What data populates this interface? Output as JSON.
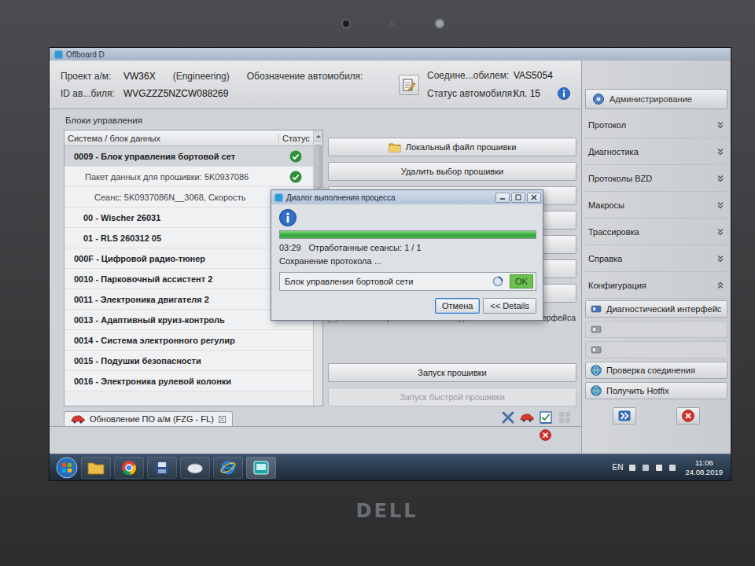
{
  "window": {
    "title": "Offboard D"
  },
  "header": {
    "project_label": "Проект а/м:",
    "project": "VW36X",
    "project_mode": "(Engineering)",
    "designation_label": "Обозначение автомобиля:",
    "id_label": "ID ав...биля:",
    "vin": "WVGZZZ5NZCW088269",
    "connection_label": "Соедине...обилем:",
    "connection": "VAS5054",
    "vehicle_status_label": "Статус автомобиля:",
    "vehicle_status": "Кл. 15"
  },
  "control_units": {
    "title": "Блоки управления",
    "columns": [
      "Система / блок данных",
      "Статус"
    ],
    "rows": [
      {
        "label": "0009 - Блок управления бортовой сет",
        "kind": "unit",
        "selected": true,
        "ok": true
      },
      {
        "label": "Пакет данных для прошивки: 5K0937086",
        "kind": "package",
        "selected": false,
        "ok": true
      },
      {
        "label": "Сеанс: 5K0937086N__3068, Скорость",
        "kind": "session",
        "selected": false,
        "ok": false
      },
      {
        "label": "00 - Wischer 26031",
        "kind": "subunit",
        "selected": false,
        "ok": false
      },
      {
        "label": "01 - RLS 260312 05",
        "kind": "subunit",
        "selected": false,
        "ok": false
      },
      {
        "label": "000F - Цифровой радио-тюнер",
        "kind": "unit",
        "selected": false,
        "ok": false
      },
      {
        "label": "0010 - Парковочный ассистент 2",
        "kind": "unit",
        "selected": false,
        "ok": false
      },
      {
        "label": "0011 - Электроника двигателя 2",
        "kind": "unit",
        "selected": false,
        "ok": false
      },
      {
        "label": "0013 - Адаптивный круиз-контроль",
        "kind": "unit",
        "selected": false,
        "ok": false
      },
      {
        "label": "0014 - Система электронного регулир",
        "kind": "unit",
        "selected": false,
        "ok": false
      },
      {
        "label": "0015 - Подушки безопасности",
        "kind": "unit",
        "selected": false,
        "ok": false
      },
      {
        "label": "0016 - Электроника рулевой колонки",
        "kind": "unit",
        "selected": false,
        "ok": false
      }
    ]
  },
  "actions": {
    "buttons": [
      {
        "label": "Локальный файл прошивки",
        "kind": "file",
        "disabled": false
      },
      {
        "label": "Удалить выбор прошивки",
        "kind": "plain",
        "disabled": false
      },
      {
        "label": "",
        "kind": "plain",
        "disabled": false
      },
      {
        "label": "",
        "kind": "plain",
        "disabled": false
      },
      {
        "label": "",
        "kind": "plain",
        "disabled": false
      },
      {
        "label": "",
        "kind": "plain",
        "disabled": false
      },
      {
        "label": "",
        "kind": "plain",
        "disabled": false
      }
    ],
    "checkbox": {
      "label": "Показать перечень элементов диагностического интерфейса",
      "checked": false
    },
    "launch": [
      {
        "label": "Запуск прошивки",
        "disabled": false
      },
      {
        "label": "Запуск быстрой прошивки",
        "disabled": true
      }
    ]
  },
  "tab": {
    "label": "Обновление ПО а/м (FZG - FL)",
    "selected": true
  },
  "sidebar": {
    "admin_button": "Администрирование",
    "items": [
      {
        "label": "Протокол",
        "expanded": false
      },
      {
        "label": "Диагностика",
        "expanded": false
      },
      {
        "label": "Протоколы BZD",
        "expanded": false
      },
      {
        "label": "Макросы",
        "expanded": false
      },
      {
        "label": "Трассировка",
        "expanded": false
      },
      {
        "label": "Справка",
        "expanded": false
      },
      {
        "label": "Конфигурация",
        "expanded": true
      }
    ],
    "config_items": [
      {
        "label": "Диагностический интерфейс",
        "kind": "interface",
        "disabled": false
      },
      {
        "label": "",
        "kind": "update",
        "disabled": true
      },
      {
        "label": "",
        "kind": "settings",
        "disabled": true
      },
      {
        "label": "Проверка соединения",
        "kind": "check",
        "disabled": false
      },
      {
        "label": "Получить Hotfix",
        "kind": "hotfix",
        "disabled": false
      }
    ]
  },
  "dialog": {
    "title": "Диалог выполнения процесса",
    "progress": {
      "level": 1
    },
    "elapsed": "03:29",
    "sessions": "Отработанные сеансы: 1 / 1",
    "status": "Сохранение протокола ...",
    "items": [
      {
        "label": "Блок управления бортовой сети",
        "result": "OK"
      }
    ],
    "buttons": [
      {
        "label": "Отмена",
        "selected": true
      },
      {
        "label": "<< Details",
        "selected": false
      }
    ]
  },
  "taskbar": {
    "language": "EN",
    "time": "11:06",
    "date": "24.08.2019"
  },
  "bezel": {
    "logo": "DELL"
  }
}
